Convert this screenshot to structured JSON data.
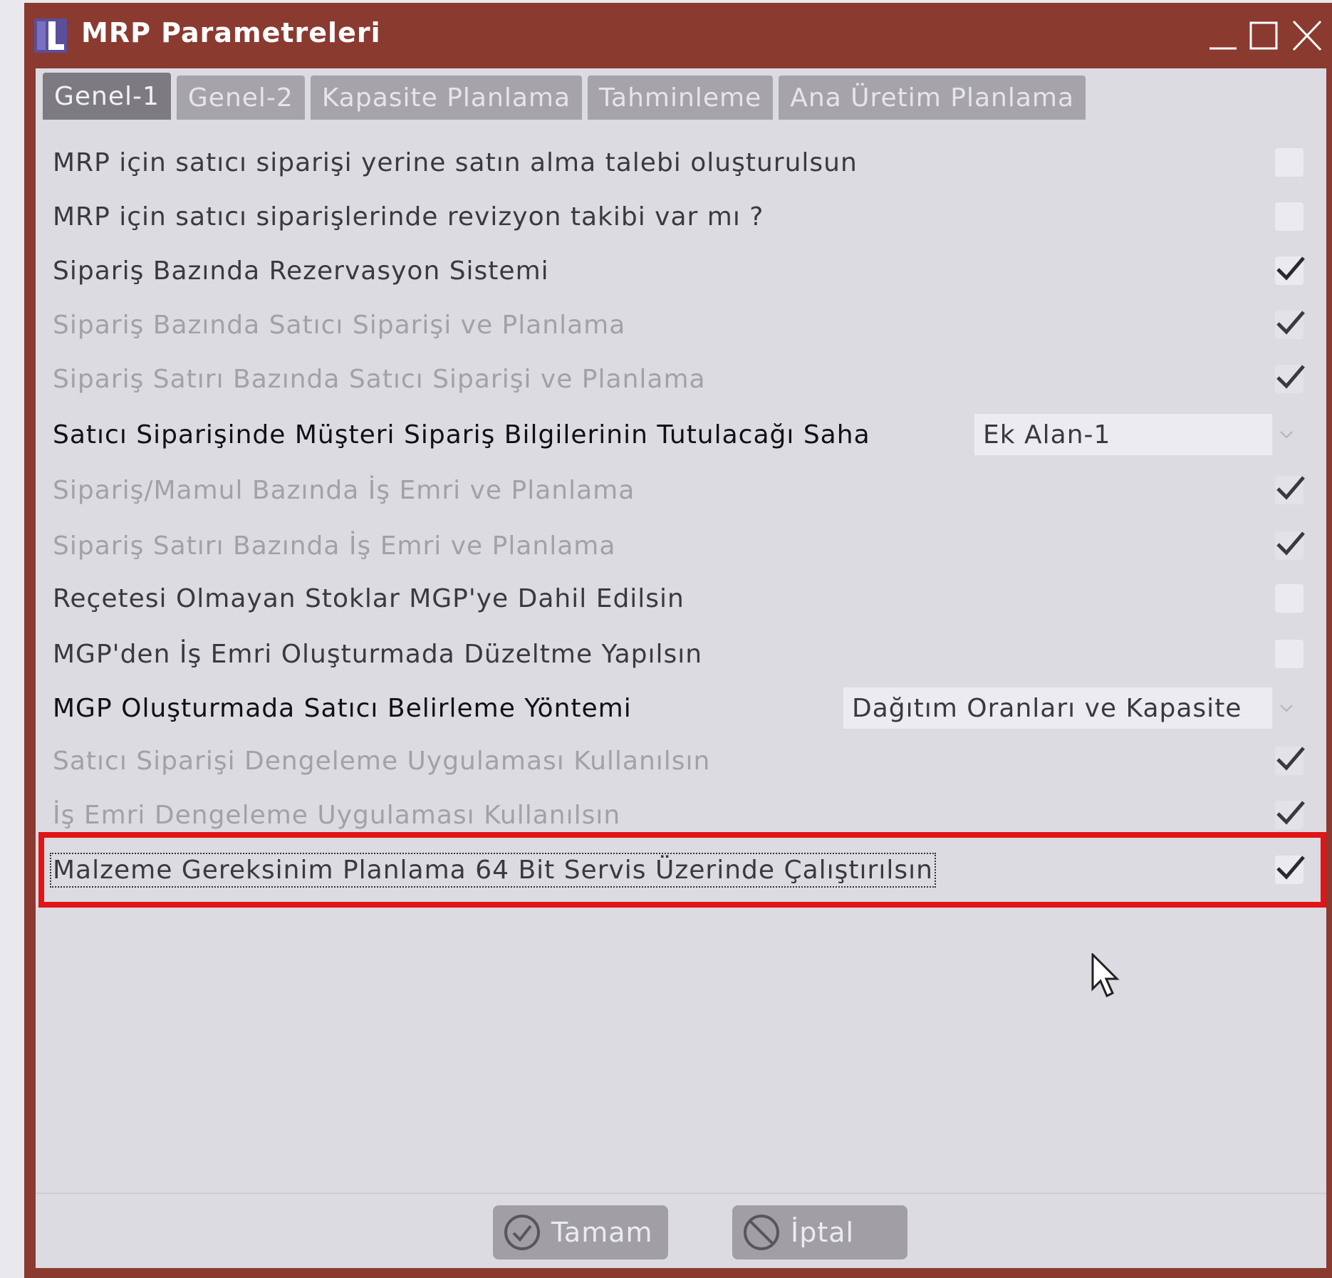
{
  "window": {
    "title": "MRP Parametreleri",
    "frame_color": "#8b3a30"
  },
  "tabs": [
    {
      "label": "Genel-1",
      "active": true
    },
    {
      "label": "Genel-2",
      "active": false
    },
    {
      "label": "Kapasite Planlama",
      "active": false
    },
    {
      "label": "Tahminleme",
      "active": false
    },
    {
      "label": "Ana Üretim Planlama",
      "active": false
    }
  ],
  "rows": [
    {
      "label": "MRP için satıcı siparişi yerine satın alma talebi oluşturulsun",
      "type": "checkbox",
      "checked": false,
      "state": "enabled"
    },
    {
      "label": "MRP için satıcı siparişlerinde revizyon takibi var mı ?",
      "type": "checkbox",
      "checked": false,
      "state": "enabled"
    },
    {
      "label": "Sipariş Bazında Rezervasyon Sistemi",
      "type": "checkbox",
      "checked": true,
      "state": "enabled"
    },
    {
      "label": "Sipariş Bazında Satıcı Siparişi ve Planlama",
      "type": "checkbox",
      "checked": true,
      "state": "disabled"
    },
    {
      "label": "Sipariş Satırı Bazında Satıcı Siparişi ve Planlama",
      "type": "checkbox",
      "checked": true,
      "state": "disabled"
    },
    {
      "label": "Satıcı Siparişinde Müşteri Sipariş Bilgilerinin Tutulacağı Saha",
      "type": "dropdown",
      "value": "Ek Alan-1",
      "state": "dark"
    },
    {
      "label": "Sipariş/Mamul Bazında İş Emri ve Planlama",
      "type": "checkbox",
      "checked": true,
      "state": "disabled"
    },
    {
      "label": "Sipariş Satırı Bazında İş Emri ve Planlama",
      "type": "checkbox",
      "checked": true,
      "state": "disabled"
    },
    {
      "label": "Reçetesi Olmayan Stoklar MGP'ye Dahil Edilsin",
      "type": "checkbox",
      "checked": false,
      "state": "enabled"
    },
    {
      "label": "MGP'den İş Emri Oluşturmada Düzeltme Yapılsın",
      "type": "checkbox",
      "checked": false,
      "state": "enabled"
    },
    {
      "label": "MGP Oluşturmada Satıcı Belirleme Yöntemi",
      "type": "dropdown",
      "value": "Dağıtım Oranları ve Kapasite",
      "state": "dark"
    },
    {
      "label": "Satıcı Siparişi Dengeleme Uygulaması Kullanılsın",
      "type": "checkbox",
      "checked": true,
      "state": "disabled"
    },
    {
      "label": "İş Emri Dengeleme Uygulaması Kullanılsın",
      "type": "checkbox",
      "checked": true,
      "state": "disabled"
    },
    {
      "label": "Malzeme Gereksinim Planlama 64 Bit Servis Üzerinde Çalıştırılsın",
      "type": "checkbox",
      "checked": true,
      "state": "enabled",
      "highlighted": true
    }
  ],
  "buttons": {
    "ok": {
      "label": "Tamam",
      "icon": "check-circle-icon"
    },
    "cancel": {
      "label": "İptal",
      "icon": "cancel-circle-icon"
    }
  },
  "highlight_color": "#e11416"
}
